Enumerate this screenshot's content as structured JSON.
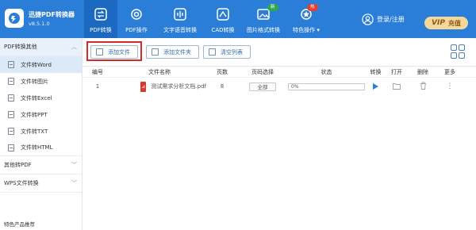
{
  "app": {
    "name": "迅捷PDF转换器",
    "version": "v8.5.1.0"
  },
  "nav": [
    {
      "label": "PDF转换",
      "icon": "convert-icon",
      "active": true
    },
    {
      "label": "PDF操作",
      "icon": "gear-icon"
    },
    {
      "label": "文字语音转换",
      "icon": "audio-wave-icon"
    },
    {
      "label": "CAD转换",
      "icon": "cad-icon"
    },
    {
      "label": "图片格式转换",
      "icon": "image-icon",
      "badge": "新",
      "badge_color": "#2ea84f"
    },
    {
      "label": "特色操作 ▾",
      "icon": "features-icon",
      "badge": "热",
      "badge_color": "#e0402f"
    }
  ],
  "header": {
    "login_label": "登录/注册",
    "vip_prefix": "VIP",
    "vip_label": "充值"
  },
  "sidebar": {
    "group_open": "PDF转换其他",
    "items": [
      {
        "label": "文件转Word",
        "active": true
      },
      {
        "label": "文件转图片"
      },
      {
        "label": "文件转Excel"
      },
      {
        "label": "文件转PPT"
      },
      {
        "label": "文件转TXT"
      },
      {
        "label": "文件转HTML"
      }
    ],
    "group2": "其他转PDF",
    "group3": "WPS文件转换",
    "footer": "特色产品推荐"
  },
  "toolbar": {
    "add_file": "添加文件",
    "add_folder": "添加文件夹",
    "clear_list": "清空列表"
  },
  "table": {
    "headers": {
      "no": "编号",
      "name": "文件名称",
      "pages": "页数",
      "range": "页码选择",
      "status": "状态",
      "convert": "转换",
      "open": "打开",
      "delete": "删除",
      "more": "更多"
    },
    "rows": [
      {
        "no": "1",
        "name": "测试需求分析文档.pdf",
        "pages": "8",
        "range": "全部",
        "progress": "0%",
        "progress_value": 0
      }
    ]
  },
  "colors": {
    "accent": "#2b7ed8",
    "nav_active": "#1c69c1",
    "highlight": "#d42a2a"
  }
}
